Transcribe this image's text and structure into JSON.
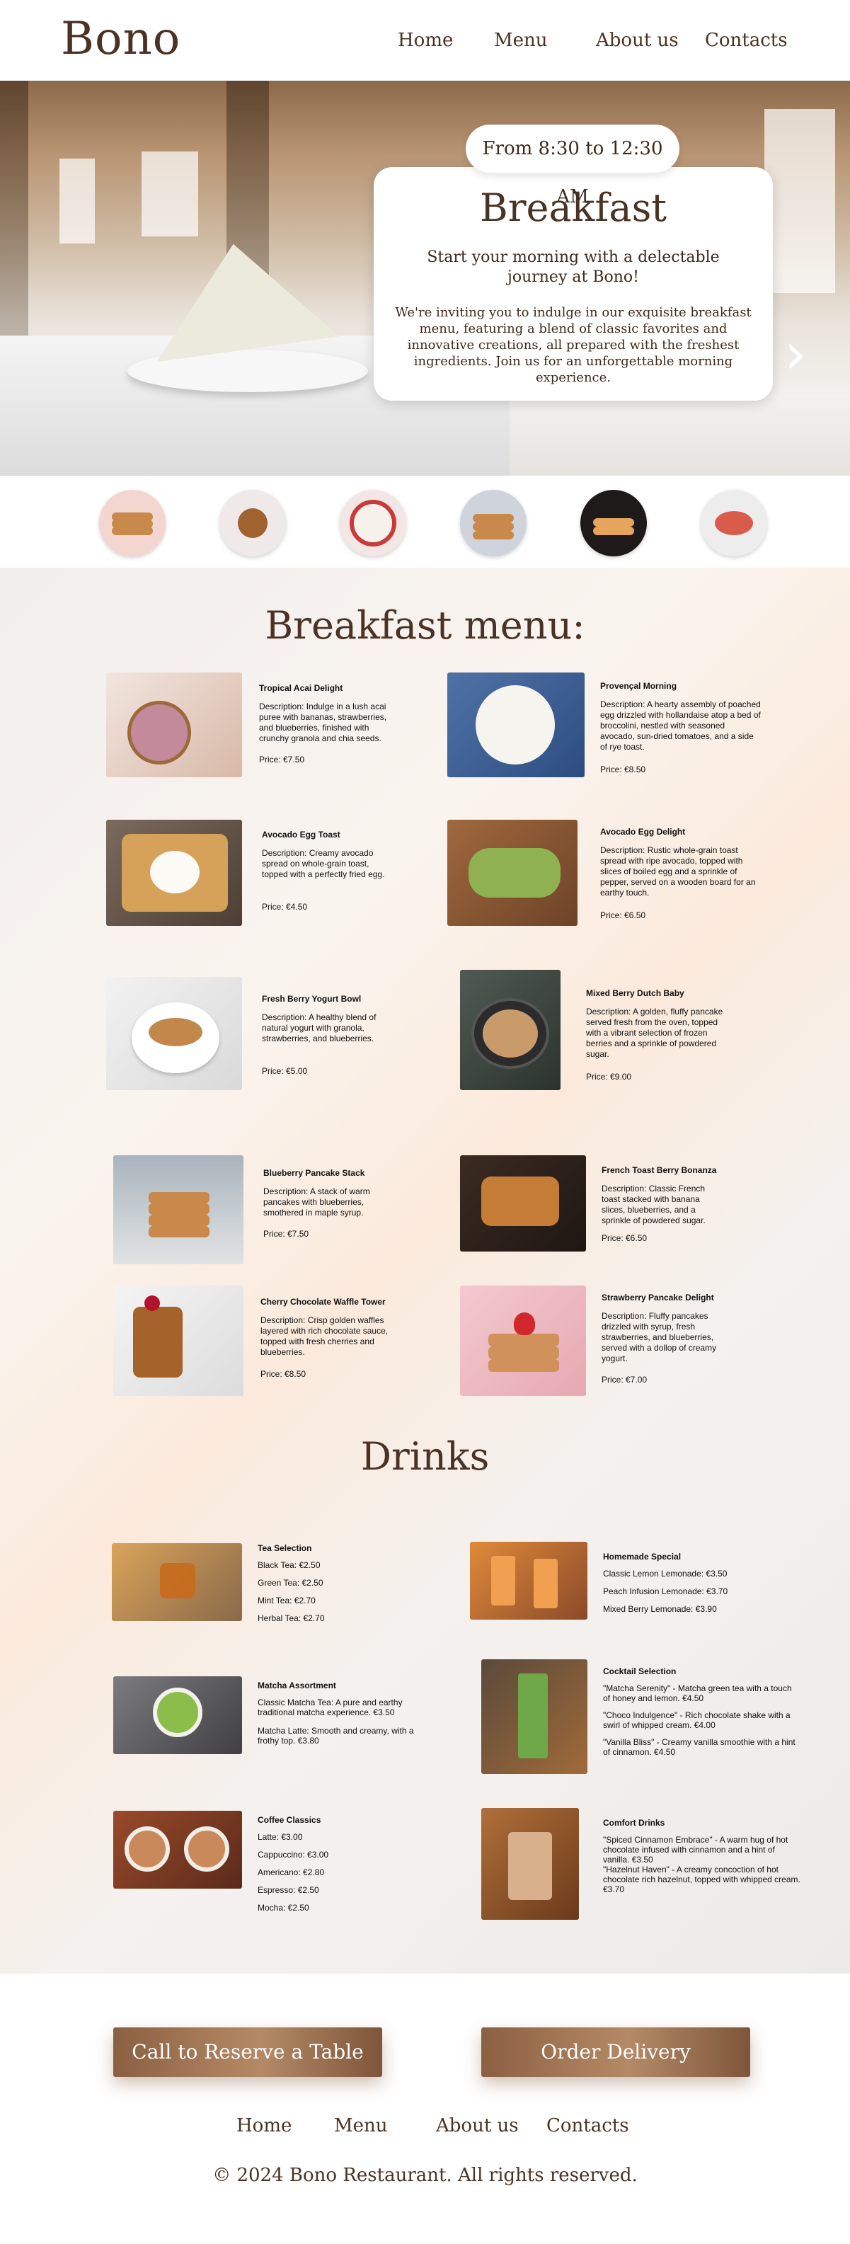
{
  "brand": "Bono",
  "nav": [
    "Home",
    "Menu",
    "About us",
    "Contacts"
  ],
  "hero": {
    "hours": "From 8:30 to 12:30 AM",
    "title": "Breakfast",
    "subtitle": "Start your morning with a delectable journey at Bono!",
    "description": "We're inviting you to indulge in our exquisite breakfast menu, featuring a blend of classic favorites and innovative creations, all prepared with the freshest ingredients. Join us for an unforgettable morning experience.",
    "next_icon": "chevron-right-icon"
  },
  "breakfast_title": "Breakfast menu:",
  "breakfast_items": [
    {
      "name": "Tropical Acai Delight",
      "desc": "Description: Indulge in a lush acai puree with bananas, strawberries, and blueberries, finished with crunchy granola and chia seeds.",
      "price": "Price: €7.50"
    },
    {
      "name": "Provençal Morning",
      "desc": "Description: A hearty assembly of poached egg drizzled with hollandaise atop a bed of broccolini, nestled with seasoned avocado, sun-dried tomatoes, and a side of rye toast.",
      "price": "Price: €8.50"
    },
    {
      "name": "Avocado Egg Toast",
      "desc": "Description: Creamy avocado spread on whole-grain toast, topped with a perfectly fried egg.",
      "price": "Price: €4.50"
    },
    {
      "name": "Avocado Egg Delight",
      "desc": "Description: Rustic whole-grain toast spread with ripe avocado, topped with slices of boiled egg and a sprinkle of pepper, served on a wooden board for an earthy touch.",
      "price": "Price: €6.50"
    },
    {
      "name": "Fresh Berry Yogurt Bowl",
      "desc": "Description: A healthy blend of natural yogurt with granola, strawberries, and blueberries.",
      "price": "Price: €5.00"
    },
    {
      "name": "Mixed Berry Dutch Baby",
      "desc": "Description: A golden, fluffy pancake served fresh from the oven, topped with a vibrant selection of frozen berries and a sprinkle of powdered sugar.",
      "price": "Price: €9.00"
    },
    {
      "name": "Blueberry Pancake Stack",
      "desc": "Description: A stack of warm pancakes with blueberries, smothered in maple syrup.",
      "price": "Price: €7.50"
    },
    {
      "name": "French Toast Berry Bonanza",
      "desc": "Description: Classic French toast stacked with banana slices, blueberries, and a sprinkle of powdered sugar.",
      "price": "Price: €6.50"
    },
    {
      "name": "Cherry Chocolate Waffle Tower",
      "desc": "Description: Crisp golden waffles layered with rich chocolate sauce, topped with fresh cherries and blueberries.",
      "price": "Price: €8.50"
    },
    {
      "name": "Strawberry Pancake Delight",
      "desc": "Description: Fluffy pancakes drizzled with syrup, fresh strawberries, and blueberries, served with a dollop of creamy yogurt.",
      "price": "Price: €7.00"
    }
  ],
  "drinks_title": "Drinks",
  "drinks": [
    {
      "name": "Tea Selection",
      "lines": [
        "Black Tea: €2.50",
        "Green Tea: €2.50",
        "Mint Tea: €2.70",
        "Herbal Tea: €2.70"
      ]
    },
    {
      "name": "Homemade Special",
      "lines": [
        "Classic Lemon Lemonade: €3.50",
        "Peach Infusion Lemonade: €3.70",
        "Mixed Berry Lemonade: €3.90"
      ]
    },
    {
      "name": "Matcha Assortment",
      "lines": [
        "Classic Matcha Tea: A pure and earthy traditional matcha experience. €3.50",
        "Matcha Latte: Smooth and creamy, with a frothy top. €3.80"
      ]
    },
    {
      "name": "Cocktail Selection",
      "lines": [
        "\"Matcha Serenity\" - Matcha green tea with a touch of honey and lemon. €4.50",
        "\"Choco Indulgence\" - Rich chocolate shake with a swirl of whipped cream. €4.00",
        "\"Vanilla Bliss\" - Creamy vanilla smoothie with a hint of cinnamon. €4.50"
      ]
    },
    {
      "name": "Coffee Classics",
      "lines": [
        "Latte: €3.00",
        "Cappuccino: €3.00",
        "Americano: €2.80",
        "Espresso: €2.50",
        "Mocha: €2.50"
      ]
    },
    {
      "name": "Comfort Drinks",
      "lines": [
        "\"Spiced Cinnamon Embrace\" - A warm hug of hot chocolate infused with cinnamon and a hint of vanilla. €3.50",
        "\"Hazelnut Haven\" - A creamy concoction of hot chocolate rich hazelnut, topped with whipped cream. €3.70"
      ]
    }
  ],
  "footer": {
    "reserve_label": "Call to Reserve a Table",
    "delivery_label": "Order Delivery",
    "nav": [
      "Home",
      "Menu",
      "About us",
      "Contacts"
    ],
    "copyright": "© 2024 Bono Restaurant. All rights reserved."
  },
  "colors": {
    "brand_brown": "#4a3324",
    "button_brown": "#a0744f"
  }
}
